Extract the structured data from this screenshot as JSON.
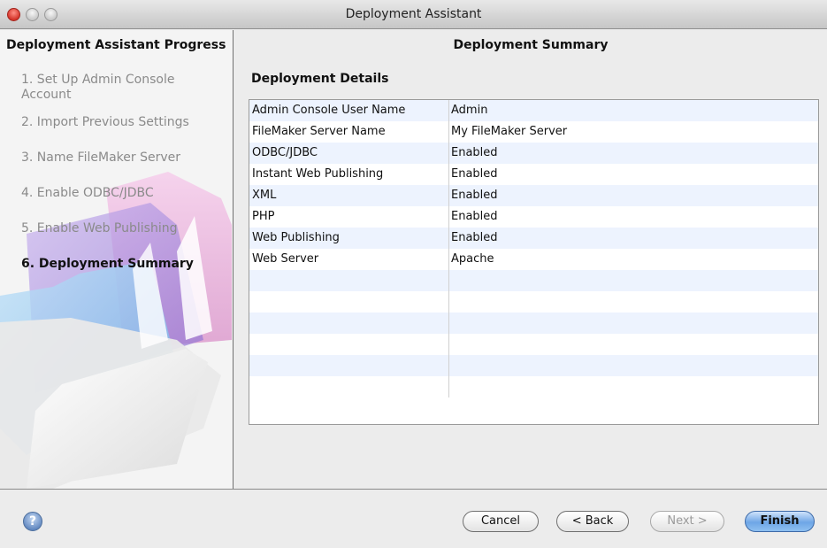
{
  "window": {
    "title": "Deployment Assistant"
  },
  "sidebar": {
    "title": "Deployment Assistant Progress",
    "steps": [
      {
        "label": "1. Set Up Admin Console Account",
        "state": "inactive"
      },
      {
        "label": "2. Import Previous Settings",
        "state": "inactive"
      },
      {
        "label": "3. Name FileMaker Server",
        "state": "inactive"
      },
      {
        "label": "4. Enable ODBC/JDBC",
        "state": "inactive"
      },
      {
        "label": "5. Enable Web Publishing",
        "state": "inactive"
      },
      {
        "label": "6. Deployment Summary",
        "state": "active"
      }
    ]
  },
  "main": {
    "title": "Deployment Summary",
    "section_label": "Deployment Details",
    "rows": [
      {
        "name": "Admin Console User Name",
        "value": "Admin"
      },
      {
        "name": "FileMaker Server Name",
        "value": "My FileMaker Server"
      },
      {
        "name": "ODBC/JDBC",
        "value": "Enabled"
      },
      {
        "name": "Instant Web Publishing",
        "value": "Enabled"
      },
      {
        "name": "XML",
        "value": "Enabled"
      },
      {
        "name": "PHP",
        "value": "Enabled"
      },
      {
        "name": "Web Publishing",
        "value": "Enabled"
      },
      {
        "name": "Web Server",
        "value": "Apache"
      },
      {
        "name": "",
        "value": ""
      },
      {
        "name": "",
        "value": ""
      },
      {
        "name": "",
        "value": ""
      },
      {
        "name": "",
        "value": ""
      },
      {
        "name": "",
        "value": ""
      },
      {
        "name": "",
        "value": ""
      }
    ]
  },
  "footer": {
    "help_icon": "help-icon",
    "help_glyph": "?",
    "cancel_label": "Cancel",
    "back_label": "< Back",
    "next_label": "Next >",
    "finish_label": "Finish"
  }
}
